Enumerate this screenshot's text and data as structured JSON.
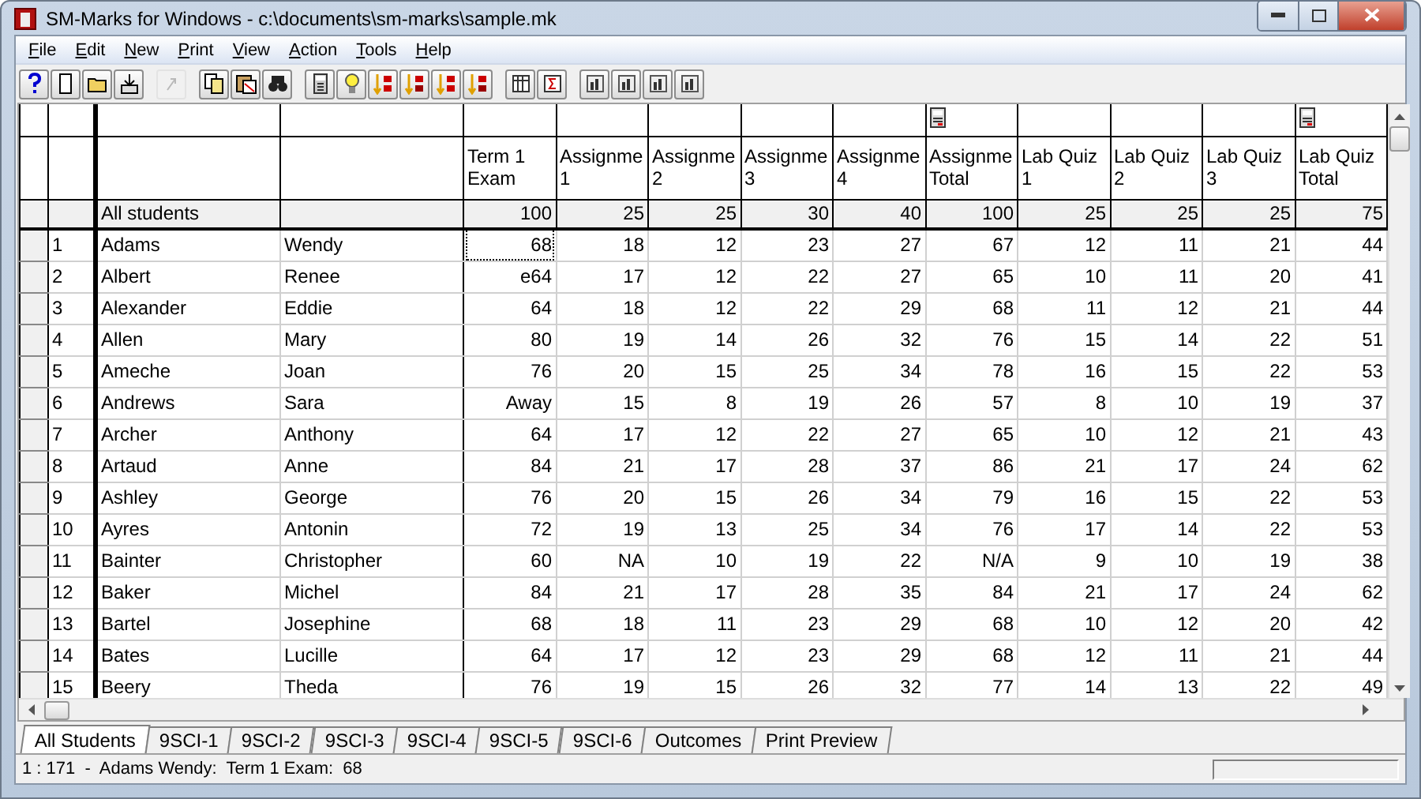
{
  "window": {
    "title": "SM-Marks for Windows - c:\\documents\\sm-marks\\sample.mk"
  },
  "menu": [
    "File",
    "Edit",
    "New",
    "Print",
    "View",
    "Action",
    "Tools",
    "Help"
  ],
  "toolbar": [
    {
      "buttons": [
        {
          "kind": "help",
          "disabled": false
        },
        {
          "kind": "new",
          "disabled": false
        },
        {
          "kind": "open",
          "disabled": false
        },
        {
          "kind": "import",
          "disabled": false
        }
      ]
    },
    {
      "buttons": [
        {
          "kind": "redo",
          "disabled": true
        }
      ]
    },
    {
      "buttons": [
        {
          "kind": "copy",
          "disabled": false
        },
        {
          "kind": "paste",
          "disabled": false
        },
        {
          "kind": "find",
          "disabled": false
        }
      ]
    },
    {
      "buttons": [
        {
          "kind": "calculator",
          "disabled": false
        },
        {
          "kind": "bulb",
          "disabled": false
        },
        {
          "kind": "sort-up",
          "disabled": false
        },
        {
          "kind": "sort-down",
          "disabled": false
        },
        {
          "kind": "sort-up",
          "disabled": false
        },
        {
          "kind": "sort-down",
          "disabled": false
        }
      ]
    },
    {
      "buttons": [
        {
          "kind": "columns",
          "disabled": false
        },
        {
          "kind": "sigma",
          "disabled": false
        }
      ]
    },
    {
      "buttons": [
        {
          "kind": "chart",
          "disabled": false
        },
        {
          "kind": "chart",
          "disabled": false
        },
        {
          "kind": "chart",
          "disabled": false
        },
        {
          "kind": "chart",
          "disabled": false
        }
      ]
    }
  ],
  "grid": {
    "all_students_label": "All students",
    "columns": [
      {
        "header": [
          "Term 1",
          "Exam"
        ],
        "calculated": false,
        "all_students": "100"
      },
      {
        "header": [
          "Assignme",
          "1"
        ],
        "calculated": false,
        "all_students": "25"
      },
      {
        "header": [
          "Assignme",
          "2"
        ],
        "calculated": false,
        "all_students": "25"
      },
      {
        "header": [
          "Assignme",
          "3"
        ],
        "calculated": false,
        "all_students": "30"
      },
      {
        "header": [
          "Assignme",
          "4"
        ],
        "calculated": false,
        "all_students": "40"
      },
      {
        "header": [
          "Assignme",
          "Total"
        ],
        "calculated": true,
        "all_students": "100"
      },
      {
        "header": [
          "Lab Quiz",
          "1"
        ],
        "calculated": false,
        "all_students": "25"
      },
      {
        "header": [
          "Lab Quiz",
          "2"
        ],
        "calculated": false,
        "all_students": "25"
      },
      {
        "header": [
          "Lab Quiz",
          "3"
        ],
        "calculated": false,
        "all_students": "25"
      },
      {
        "header": [
          "Lab Quiz",
          "Total"
        ],
        "calculated": true,
        "all_students": "75"
      }
    ],
    "rows": [
      {
        "number": "1",
        "last": "Adams",
        "first": "Wendy",
        "selected": true,
        "cells": [
          "68",
          "18",
          "12",
          "23",
          "27",
          "67",
          "12",
          "11",
          "21",
          "44"
        ]
      },
      {
        "number": "2",
        "last": "Albert",
        "first": "Renee",
        "selected": false,
        "cells": [
          "e64",
          "17",
          "12",
          "22",
          "27",
          "65",
          "10",
          "11",
          "20",
          "41"
        ]
      },
      {
        "number": "3",
        "last": "Alexander",
        "first": "Eddie",
        "selected": false,
        "cells": [
          "64",
          "18",
          "12",
          "22",
          "29",
          "68",
          "11",
          "12",
          "21",
          "44"
        ]
      },
      {
        "number": "4",
        "last": "Allen",
        "first": "Mary",
        "selected": false,
        "cells": [
          "80",
          "19",
          "14",
          "26",
          "32",
          "76",
          "15",
          "14",
          "22",
          "51"
        ]
      },
      {
        "number": "5",
        "last": "Ameche",
        "first": "Joan",
        "selected": false,
        "cells": [
          "76",
          "20",
          "15",
          "25",
          "34",
          "78",
          "16",
          "15",
          "22",
          "53"
        ]
      },
      {
        "number": "6",
        "last": "Andrews",
        "first": "Sara",
        "selected": false,
        "cells": [
          "Away",
          "15",
          "8",
          "19",
          "26",
          "57",
          "8",
          "10",
          "19",
          "37"
        ]
      },
      {
        "number": "7",
        "last": "Archer",
        "first": "Anthony",
        "selected": false,
        "cells": [
          "64",
          "17",
          "12",
          "22",
          "27",
          "65",
          "10",
          "12",
          "21",
          "43"
        ]
      },
      {
        "number": "8",
        "last": "Artaud",
        "first": "Anne",
        "selected": false,
        "cells": [
          "84",
          "21",
          "17",
          "28",
          "37",
          "86",
          "21",
          "17",
          "24",
          "62"
        ]
      },
      {
        "number": "9",
        "last": "Ashley",
        "first": "George",
        "selected": false,
        "cells": [
          "76",
          "20",
          "15",
          "26",
          "34",
          "79",
          "16",
          "15",
          "22",
          "53"
        ]
      },
      {
        "number": "10",
        "last": "Ayres",
        "first": "Antonin",
        "selected": false,
        "cells": [
          "72",
          "19",
          "13",
          "25",
          "34",
          "76",
          "17",
          "14",
          "22",
          "53"
        ]
      },
      {
        "number": "11",
        "last": "Bainter",
        "first": "Christopher",
        "selected": false,
        "cells": [
          "60",
          "NA",
          "10",
          "19",
          "22",
          "N/A",
          "9",
          "10",
          "19",
          "38"
        ]
      },
      {
        "number": "12",
        "last": "Baker",
        "first": "Michel",
        "selected": false,
        "cells": [
          "84",
          "21",
          "17",
          "28",
          "35",
          "84",
          "21",
          "17",
          "24",
          "62"
        ]
      },
      {
        "number": "13",
        "last": "Bartel",
        "first": "Josephine",
        "selected": false,
        "cells": [
          "68",
          "18",
          "11",
          "23",
          "29",
          "68",
          "10",
          "12",
          "20",
          "42"
        ]
      },
      {
        "number": "14",
        "last": "Bates",
        "first": "Lucille",
        "selected": false,
        "cells": [
          "64",
          "17",
          "12",
          "23",
          "29",
          "68",
          "12",
          "11",
          "21",
          "44"
        ]
      },
      {
        "number": "15",
        "last": "Beery",
        "first": "Theda",
        "selected": false,
        "cells": [
          "76",
          "19",
          "15",
          "26",
          "32",
          "77",
          "14",
          "13",
          "22",
          "49"
        ]
      }
    ]
  },
  "sheet_tabs": [
    {
      "label": "All Students",
      "selected": true
    },
    {
      "label": "9SCI-1",
      "selected": false
    },
    {
      "label": "9SCI-2",
      "selected": false
    },
    {
      "label": "9SCI-3",
      "selected": false
    },
    {
      "label": "9SCI-4",
      "selected": false
    },
    {
      "label": "9SCI-5",
      "selected": false
    },
    {
      "label": "9SCI-6",
      "selected": false
    },
    {
      "label": "Outcomes",
      "selected": false
    },
    {
      "label": "Print Preview",
      "selected": false
    }
  ],
  "status_bar": {
    "text": "1 : 171  -  Adams Wendy:  Term 1 Exam:  68"
  }
}
